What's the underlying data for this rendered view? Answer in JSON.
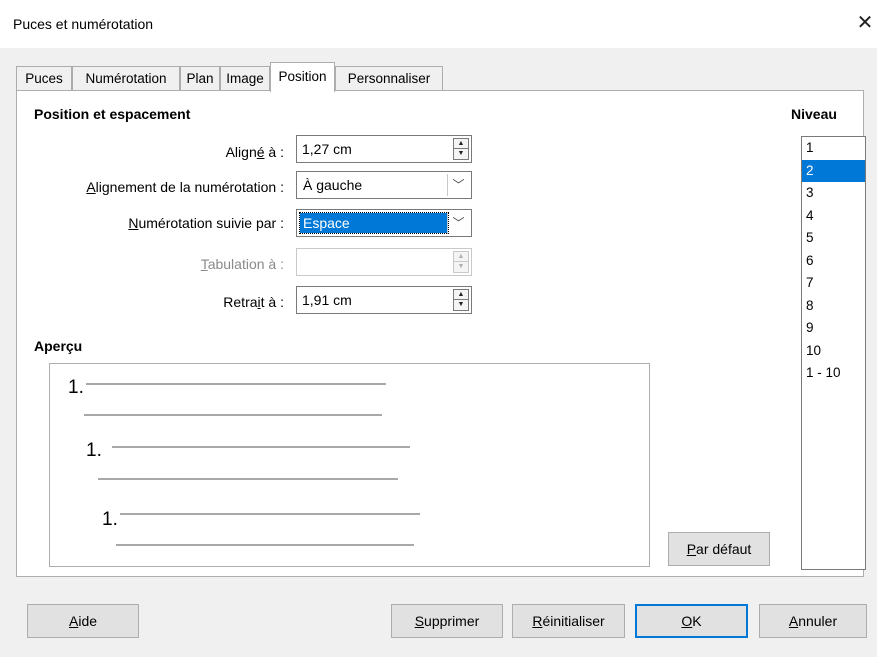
{
  "window": {
    "title": "Puces et numérotation"
  },
  "tabs": [
    {
      "label": "Puces"
    },
    {
      "label": "Numérotation"
    },
    {
      "label": "Plan"
    },
    {
      "label": "Image"
    },
    {
      "label": "Position"
    },
    {
      "label": "Personnaliser"
    }
  ],
  "active_tab": "Position",
  "position_section": {
    "title": "Position et espacement",
    "aligned_at": {
      "label_pre": "Align",
      "label_u": "é",
      "label_post": " à :",
      "value": "1,27 cm"
    },
    "numbering_alignment": {
      "label_pre": "",
      "label_u": "A",
      "label_post": "lignement de la numérotation :",
      "value": "À gauche"
    },
    "numbering_followed_by": {
      "label_pre": "",
      "label_u": "N",
      "label_post": "umérotation suivie par :",
      "value": "Espace"
    },
    "tab_stop_at": {
      "label_pre": "",
      "label_u": "T",
      "label_post": "abulation à :",
      "value": ""
    },
    "indent_at": {
      "label_pre": "Retra",
      "label_u": "i",
      "label_post": "t à :",
      "value": "1,91 cm"
    }
  },
  "preview": {
    "title": "Aperçu",
    "levels": [
      "1.",
      "1.",
      "1."
    ]
  },
  "level": {
    "title": "Niveau",
    "items": [
      "1",
      "2",
      "3",
      "4",
      "5",
      "6",
      "7",
      "8",
      "9",
      "10",
      "1 - 10"
    ],
    "selected": "2"
  },
  "buttons": {
    "default": {
      "u": "P",
      "rest": "ar défaut"
    },
    "help": {
      "u": "A",
      "rest": "ide"
    },
    "delete": {
      "u": "S",
      "rest": "upprimer"
    },
    "reset": {
      "u": "R",
      "rest": "éinitialiser"
    },
    "ok": {
      "u": "O",
      "rest": "K"
    },
    "cancel": {
      "u": "A",
      "rest": "nnuler"
    }
  }
}
